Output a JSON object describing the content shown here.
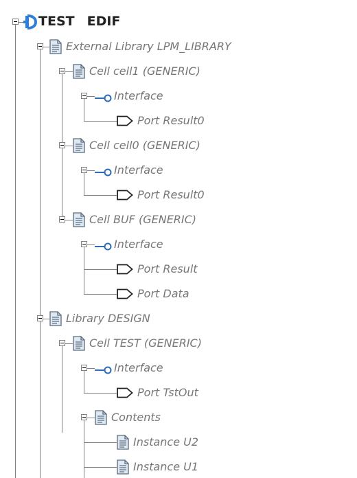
{
  "tree": {
    "root": {
      "name": "TEST",
      "type": "EDIF"
    },
    "rows": [
      {
        "label": "External Library LPM_LIBRARY",
        "level": 1,
        "icon": "document-icon",
        "expanded": true
      },
      {
        "label": "Cell cell1 (GENERIC)",
        "level": 2,
        "icon": "document-icon",
        "expanded": true
      },
      {
        "label": "Interface",
        "level": 3,
        "icon": "interface-icon",
        "expanded": true
      },
      {
        "label": "Port Result0",
        "level": 4,
        "icon": "port-icon",
        "expanded": false
      },
      {
        "label": "Cell cell0 (GENERIC)",
        "level": 2,
        "icon": "document-icon",
        "expanded": true
      },
      {
        "label": "Interface",
        "level": 3,
        "icon": "interface-icon",
        "expanded": true
      },
      {
        "label": "Port Result0",
        "level": 4,
        "icon": "port-icon",
        "expanded": false
      },
      {
        "label": "Cell BUF (GENERIC)",
        "level": 2,
        "icon": "document-icon",
        "expanded": true
      },
      {
        "label": "Interface",
        "level": 3,
        "icon": "interface-icon",
        "expanded": true
      },
      {
        "label": "Port Result",
        "level": 4,
        "icon": "port-icon",
        "expanded": false
      },
      {
        "label": "Port Data",
        "level": 4,
        "icon": "port-icon",
        "expanded": false
      },
      {
        "label": "Library DESIGN",
        "level": 1,
        "icon": "document-icon",
        "expanded": true
      },
      {
        "label": "Cell TEST (GENERIC)",
        "level": 2,
        "icon": "document-icon",
        "expanded": true
      },
      {
        "label": "Interface",
        "level": 3,
        "icon": "interface-icon",
        "expanded": true
      },
      {
        "label": "Port TstOut",
        "level": 4,
        "icon": "port-icon",
        "expanded": false
      },
      {
        "label": "Contents",
        "level": 3,
        "icon": "document-icon",
        "expanded": true
      },
      {
        "label": "Instance U2",
        "level": 4,
        "icon": "document-icon",
        "expanded": false
      },
      {
        "label": "Instance U1",
        "level": 4,
        "icon": "document-icon",
        "expanded": false
      }
    ]
  },
  "colors": {
    "connector": "#808080",
    "label": "#777777",
    "root_label": "#222222",
    "root_icon": "#2f7fd6",
    "doc_icon": "#dde8f3",
    "interface_icon": "#2d6bb8"
  }
}
